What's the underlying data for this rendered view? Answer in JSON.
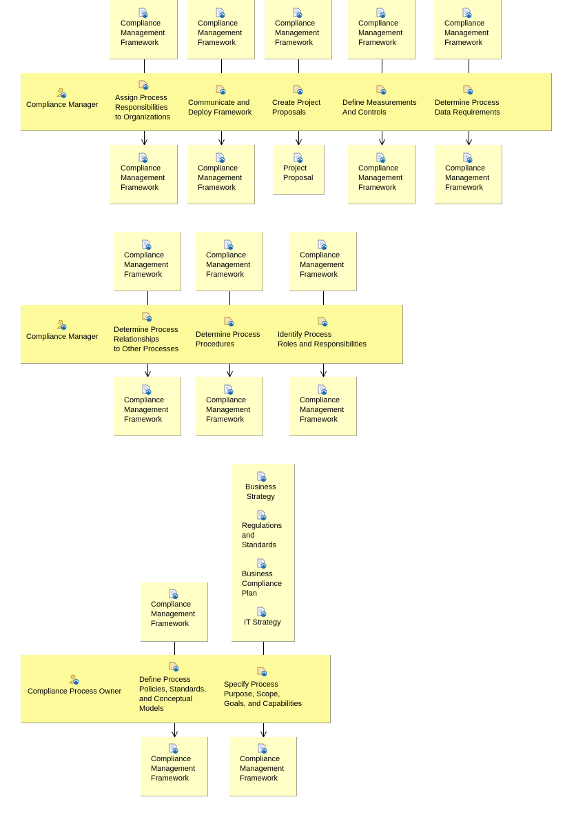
{
  "colors": {
    "lane": "#fdfa9c",
    "document": "#ffffc6",
    "wire": "#000000"
  },
  "icons": {
    "document": "document-icon",
    "task": "task-icon",
    "role": "role-icon"
  },
  "diagrams": [
    {
      "role": "Compliance Manager",
      "tasks": [
        {
          "label": "Assign Process\nResponsibilities\nto Organizations",
          "input": "Compliance\nManagement\nFramework",
          "output": "Compliance\nManagement\nFramework"
        },
        {
          "label": "Communicate and\nDeploy Framework",
          "input": "Compliance\nManagement\nFramework",
          "output": "Compliance\nManagement\nFramework"
        },
        {
          "label": "Create Project\nProposals",
          "input": "Compliance\nManagement\nFramework",
          "output": "Project\nProposal"
        },
        {
          "label": "Define Measurements\nAnd Controls",
          "input": "Compliance\nManagement\nFramework",
          "output": "Compliance\nManagement\nFramework"
        },
        {
          "label": "Determine Process\nData Requirements",
          "input": "Compliance\nManagement\nFramework",
          "output": "Compliance\nManagement\nFramework"
        }
      ]
    },
    {
      "role": "Compliance Manager",
      "tasks": [
        {
          "label": "Determine Process\nRelationships\nto Other Processes",
          "input": "Compliance\nManagement\nFramework",
          "output": "Compliance\nManagement\nFramework"
        },
        {
          "label": "Determine Process\nProcedures",
          "input": "Compliance\nManagement\nFramework",
          "output": "Compliance\nManagement\nFramework"
        },
        {
          "label": "Identify Process\nRoles and Responsibilities",
          "input": "Compliance\nManagement\nFramework",
          "output": "Compliance\nManagement\nFramework"
        }
      ]
    },
    {
      "role": "Compliance Process Owner",
      "tasks": [
        {
          "label": "Define Process\nPolicies, Standards,\nand Conceptual\nModels",
          "input": "Compliance\nManagement\nFramework",
          "output": "Compliance\nManagement\nFramework"
        },
        {
          "label": "Specify Process\nPurpose, Scope,\nGoals, and Capabilities",
          "inputs": [
            "Business\nStrategy",
            "Regulations\nand\nStandards",
            "Business\nCompliance\nPlan",
            "IT Strategy"
          ],
          "output": "Compliance\nManagement\nFramework"
        }
      ]
    }
  ]
}
